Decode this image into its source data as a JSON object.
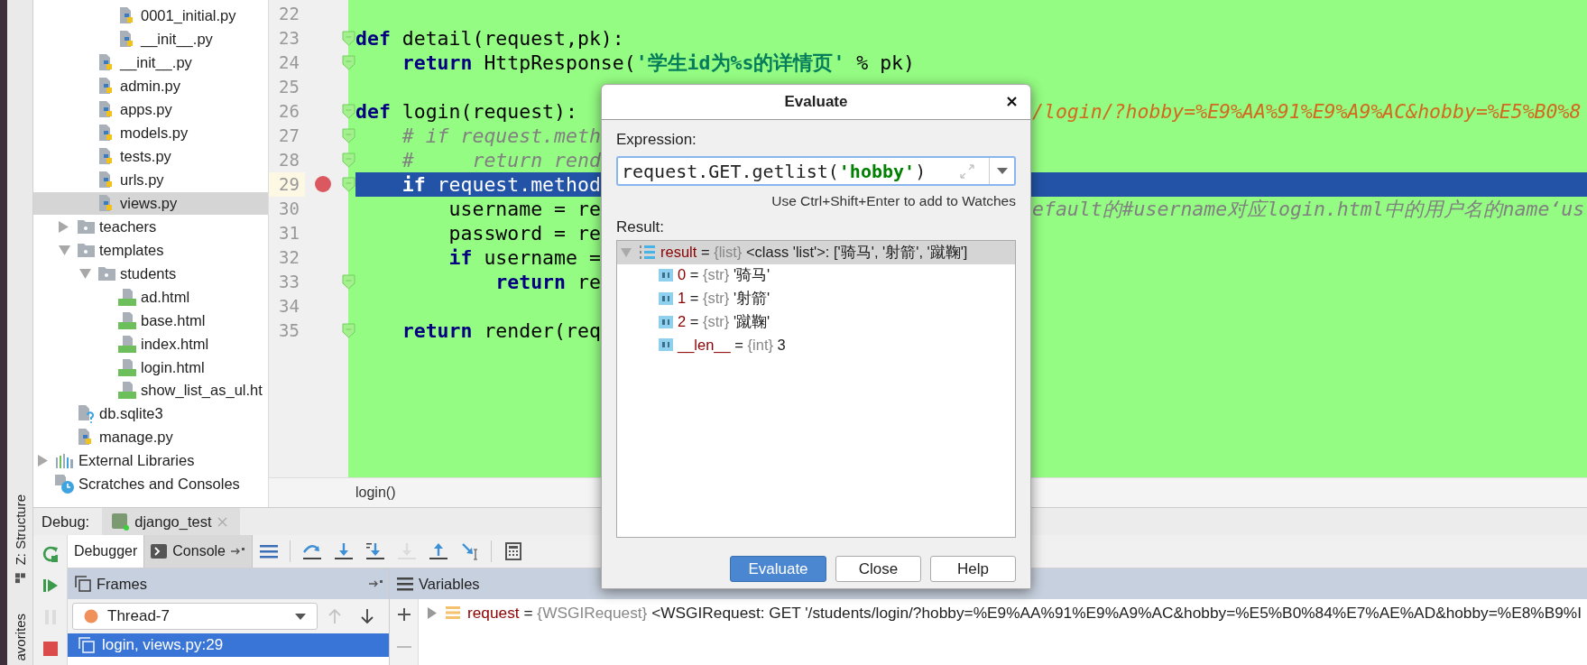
{
  "project_tree": [
    {
      "children": [
        {
          "children": [
            {
              "children": [
                {
                  "label": "0001_initial.py",
                  "kind": "python",
                  "selected": false
                },
                {
                  "label": "__init__.py",
                  "kind": "python",
                  "selected": false
                }
              ]
            },
            {
              "label": "__init__.py",
              "kind": "python",
              "selected": false
            },
            {
              "label": "admin.py",
              "kind": "python",
              "selected": false
            },
            {
              "label": "apps.py",
              "kind": "python",
              "selected": false
            },
            {
              "label": "models.py",
              "kind": "python",
              "selected": false
            },
            {
              "label": "tests.py",
              "kind": "python",
              "selected": false
            },
            {
              "label": "urls.py",
              "kind": "python",
              "selected": false
            },
            {
              "label": "views.py",
              "kind": "python",
              "selected": true
            }
          ]
        },
        {
          "label": "teachers",
          "kind": "folder",
          "expanded": false,
          "selected": false
        },
        {
          "label": "templates",
          "kind": "folder",
          "expanded": true,
          "selected": false,
          "children": [
            {
              "label": "students",
              "kind": "folder",
              "expanded": true,
              "selected": false,
              "children": [
                {
                  "label": "ad.html",
                  "kind": "html",
                  "selected": false
                },
                {
                  "label": "base.html",
                  "kind": "html",
                  "selected": false
                },
                {
                  "label": "index.html",
                  "kind": "html",
                  "selected": false
                },
                {
                  "label": "login.html",
                  "kind": "html",
                  "selected": false
                },
                {
                  "label": "show_list_as_ul.ht",
                  "kind": "html",
                  "selected": false
                }
              ]
            }
          ]
        },
        {
          "label": "db.sqlite3",
          "kind": "database",
          "selected": false
        },
        {
          "label": "manage.py",
          "kind": "python",
          "selected": false
        }
      ]
    },
    {
      "label": "External Libraries",
      "kind": "libraries",
      "expanded": false,
      "selected": false
    },
    {
      "label": "Scratches and Consoles",
      "kind": "scratches",
      "selected": false
    }
  ],
  "editor": {
    "lines": [
      {
        "number": "22",
        "fold": false,
        "breakpoint": false,
        "current": false
      },
      {
        "number": "23",
        "fold": true,
        "breakpoint": false,
        "current": false,
        "segments": [
          {
            "kind": "keyword",
            "text": "def"
          },
          {
            "kind": "plain",
            "text": " detail(request,pk):"
          }
        ]
      },
      {
        "number": "24",
        "fold": true,
        "breakpoint": false,
        "current": false,
        "segments": [
          {
            "kind": "keyword",
            "text": "    return"
          },
          {
            "kind": "plain",
            "text": " HttpResponse("
          },
          {
            "kind": "string",
            "text": "'学生id为%s的详情页'"
          },
          {
            "kind": "plain",
            "text": " % pk)"
          }
        ]
      },
      {
        "number": "25",
        "fold": false,
        "breakpoint": false,
        "current": false
      },
      {
        "number": "26",
        "fold": true,
        "breakpoint": false,
        "current": false,
        "segments": [
          {
            "kind": "keyword",
            "text": "def"
          },
          {
            "kind": "plain",
            "text": " login(request):"
          }
        ],
        "tail": {
          "kind": "highlighted_comment",
          "text": "/login/?hobby=%E9%AA%91%E9%A9%AC&hobby=%E5%B0%8"
        }
      },
      {
        "number": "27",
        "fold": true,
        "breakpoint": false,
        "current": false,
        "segments": [
          {
            "kind": "comment",
            "text": "    # if request.meth"
          }
        ]
      },
      {
        "number": "28",
        "fold": true,
        "breakpoint": false,
        "current": false,
        "segments": [
          {
            "kind": "comment",
            "text": "    #     return rend"
          }
        ]
      },
      {
        "number": "29",
        "fold": true,
        "breakpoint": true,
        "current": true,
        "segments": [
          {
            "kind": "keyword",
            "text": "    if"
          },
          {
            "kind": "plain",
            "text": " request.method"
          }
        ]
      },
      {
        "number": "30",
        "fold": false,
        "breakpoint": false,
        "current": false,
        "segments": [
          {
            "kind": "plain",
            "text": "        username = re"
          }
        ],
        "tail": {
          "kind": "comment",
          "text": "efault的#username对应login.html中的用户名的name‘us"
        }
      },
      {
        "number": "31",
        "fold": false,
        "breakpoint": false,
        "current": false,
        "segments": [
          {
            "kind": "plain",
            "text": "        password = re"
          }
        ]
      },
      {
        "number": "32",
        "fold": false,
        "breakpoint": false,
        "current": false,
        "segments": [
          {
            "kind": "keyword",
            "text": "        if"
          },
          {
            "kind": "plain",
            "text": " username ="
          }
        ]
      },
      {
        "number": "33",
        "fold": true,
        "breakpoint": false,
        "current": false,
        "segments": [
          {
            "kind": "keyword",
            "text": "            return"
          },
          {
            "kind": "plain",
            "text": " re"
          }
        ]
      },
      {
        "number": "34",
        "fold": false,
        "breakpoint": false,
        "current": false
      },
      {
        "number": "35",
        "fold": true,
        "breakpoint": false,
        "current": false,
        "segments": [
          {
            "kind": "keyword",
            "text": "    return"
          },
          {
            "kind": "plain",
            "text": " render(req"
          }
        ]
      }
    ],
    "breadcrumb": "login()"
  },
  "side_tool_tabs": [
    {
      "kind": "structure",
      "label": "Z: Structure"
    },
    {
      "kind": "favorites",
      "label": "avorites"
    }
  ],
  "debug": {
    "label": "Debug:",
    "tabs": [
      {
        "label": "django_test",
        "selected": true
      }
    ],
    "side_buttons": [
      {
        "kind": "rerun",
        "disabled": false
      },
      {
        "kind": "resume",
        "disabled": false
      },
      {
        "kind": "pause",
        "disabled": true
      },
      {
        "kind": "stop",
        "disabled": false
      }
    ],
    "view_tabs": [
      {
        "label": "Debugger",
        "selected": true
      },
      {
        "label": "Console",
        "selected": false
      }
    ],
    "toolbar": [
      {
        "kind": "show_execution_point",
        "disabled": false
      },
      {
        "kind": "step_over",
        "disabled": false
      },
      {
        "kind": "step_into",
        "disabled": false
      },
      {
        "kind": "step_into_my_code",
        "disabled": false
      },
      {
        "kind": "force_step_into",
        "disabled": true
      },
      {
        "kind": "step_out",
        "disabled": false
      },
      {
        "kind": "run_to_cursor",
        "disabled": false
      },
      {
        "kind": "evaluate",
        "disabled": false
      }
    ],
    "frames": {
      "title": "Frames",
      "thread": "Thread-7",
      "nav": [
        {
          "kind": "up",
          "disabled": true
        },
        {
          "kind": "down",
          "disabled": false
        }
      ],
      "items": [
        {
          "label": "login, views.py:29",
          "selected": true
        }
      ]
    },
    "variables": {
      "title": "Variables",
      "items": [
        {
          "name": "request",
          "separator": "=",
          "type": "{WSGIRequest}",
          "value": "<WSGIRequest: GET '/students/login/?hobby=%E9%AA%91%E9%A9%AC&hobby=%E5%B0%84%E7%AE%AD&hobby=%E8%B9%I",
          "expanded": false
        }
      ]
    }
  },
  "dialog": {
    "title": "Evaluate",
    "expression_label": "Expression:",
    "expression": [
      {
        "kind": "plain",
        "text": "request.GET.getlist("
      },
      {
        "kind": "string",
        "text": "'hobby'"
      },
      {
        "kind": "plain",
        "text": ")"
      }
    ],
    "hint": "Use Ctrl+Shift+Enter to add to Watches",
    "result_label": "Result:",
    "result": [
      {
        "name": "result",
        "separator": "=",
        "type": "{list}",
        "value": "<class 'list'>: ['骑马', '射箭', '蹴鞠']",
        "kind": "list",
        "expanded": true,
        "selected": true,
        "children": [
          {
            "name": "0",
            "separator": "=",
            "type": "{str}",
            "value": "'骑马'",
            "kind": "value",
            "selected": false
          },
          {
            "name": "1",
            "separator": "=",
            "type": "{str}",
            "value": "'射箭'",
            "kind": "value",
            "selected": false
          },
          {
            "name": "2",
            "separator": "=",
            "type": "{str}",
            "value": "'蹴鞠'",
            "kind": "value",
            "selected": false
          },
          {
            "name": "__len__",
            "separator": "=",
            "type": "{int}",
            "value": "3",
            "kind": "value",
            "selected": false
          }
        ]
      }
    ],
    "buttons": [
      {
        "label": "Evaluate",
        "primary": true
      },
      {
        "label": "Close",
        "primary": false
      },
      {
        "label": "Help",
        "primary": false
      }
    ]
  }
}
